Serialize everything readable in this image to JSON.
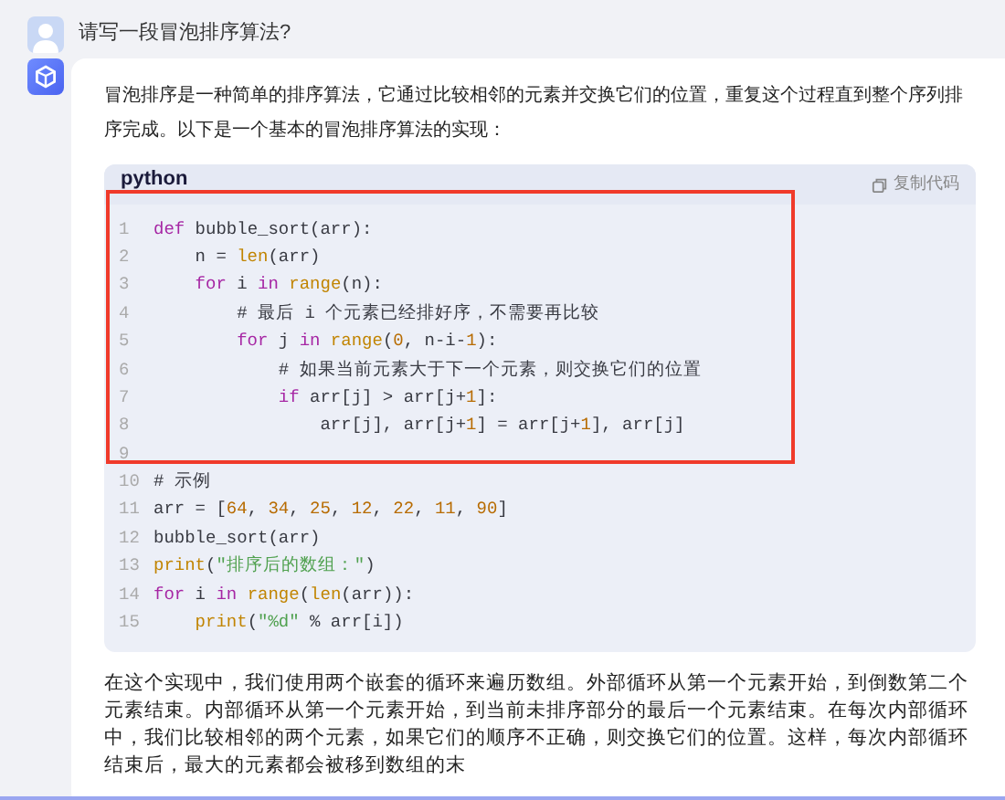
{
  "question": {
    "text": "请写一段冒泡排序算法?"
  },
  "answer": {
    "intro": "冒泡排序是一种简单的排序算法，它通过比较相邻的元素并交换它们的位置，重复这个过程直到整个序列排序完成。以下是一个基本的冒泡排序算法的实现：",
    "code": {
      "language": "python",
      "copy_label": "复制代码",
      "highlight": true,
      "lines": [
        {
          "number": "1",
          "tokens": [
            {
              "kind": "keyword",
              "text": "def"
            },
            {
              "kind": "plain",
              "text": " bubble_sort(arr):"
            }
          ]
        },
        {
          "number": "2",
          "tokens": [
            {
              "kind": "plain",
              "text": "    n = "
            },
            {
              "kind": "builtin",
              "text": "len"
            },
            {
              "kind": "plain",
              "text": "(arr)"
            }
          ]
        },
        {
          "number": "3",
          "tokens": [
            {
              "kind": "keyword",
              "text": "    for"
            },
            {
              "kind": "plain",
              "text": " i "
            },
            {
              "kind": "keyword",
              "text": "in"
            },
            {
              "kind": "builtin",
              "text": " range"
            },
            {
              "kind": "plain",
              "text": "(n):"
            }
          ]
        },
        {
          "number": "4",
          "tokens": [
            {
              "kind": "comment",
              "text": "        # 最后 i 个元素已经排好序，不需要再比较"
            }
          ]
        },
        {
          "number": "5",
          "tokens": [
            {
              "kind": "keyword",
              "text": "        for"
            },
            {
              "kind": "plain",
              "text": " j "
            },
            {
              "kind": "keyword",
              "text": "in"
            },
            {
              "kind": "builtin",
              "text": " range"
            },
            {
              "kind": "plain",
              "text": "("
            },
            {
              "kind": "number",
              "text": "0"
            },
            {
              "kind": "plain",
              "text": ", n-i-"
            },
            {
              "kind": "number",
              "text": "1"
            },
            {
              "kind": "plain",
              "text": "):"
            }
          ]
        },
        {
          "number": "6",
          "tokens": [
            {
              "kind": "comment",
              "text": "            # 如果当前元素大于下一个元素，则交换它们的位置"
            }
          ]
        },
        {
          "number": "7",
          "tokens": [
            {
              "kind": "keyword",
              "text": "            if"
            },
            {
              "kind": "plain",
              "text": " arr[j] > arr[j+"
            },
            {
              "kind": "number",
              "text": "1"
            },
            {
              "kind": "plain",
              "text": "]:"
            }
          ]
        },
        {
          "number": "8",
          "tokens": [
            {
              "kind": "plain",
              "text": "                arr[j], arr[j+"
            },
            {
              "kind": "number",
              "text": "1"
            },
            {
              "kind": "plain",
              "text": "] = arr[j+"
            },
            {
              "kind": "number",
              "text": "1"
            },
            {
              "kind": "plain",
              "text": "], arr[j]"
            }
          ]
        },
        {
          "number": "9"
        },
        {
          "number": "10",
          "tokens": [
            {
              "kind": "comment",
              "text": "# 示例"
            }
          ]
        },
        {
          "number": "11",
          "tokens": [
            {
              "kind": "plain",
              "text": "arr = ["
            },
            {
              "kind": "number",
              "text": "64"
            },
            {
              "kind": "plain",
              "text": ", "
            },
            {
              "kind": "number",
              "text": "34"
            },
            {
              "kind": "plain",
              "text": ", "
            },
            {
              "kind": "number",
              "text": "25"
            },
            {
              "kind": "plain",
              "text": ", "
            },
            {
              "kind": "number",
              "text": "12"
            },
            {
              "kind": "plain",
              "text": ", "
            },
            {
              "kind": "number",
              "text": "22"
            },
            {
              "kind": "plain",
              "text": ", "
            },
            {
              "kind": "number",
              "text": "11"
            },
            {
              "kind": "plain",
              "text": ", "
            },
            {
              "kind": "number",
              "text": "90"
            },
            {
              "kind": "plain",
              "text": "]"
            }
          ]
        },
        {
          "number": "12",
          "tokens": [
            {
              "kind": "plain",
              "text": "bubble_sort(arr)"
            }
          ]
        },
        {
          "number": "13",
          "tokens": [
            {
              "kind": "builtin",
              "text": "print"
            },
            {
              "kind": "plain",
              "text": "("
            },
            {
              "kind": "string",
              "text": "\"排序后的数组：\""
            },
            {
              "kind": "plain",
              "text": ")"
            }
          ]
        },
        {
          "number": "14",
          "tokens": [
            {
              "kind": "keyword",
              "text": "for"
            },
            {
              "kind": "plain",
              "text": " i "
            },
            {
              "kind": "keyword",
              "text": "in"
            },
            {
              "kind": "builtin",
              "text": " range"
            },
            {
              "kind": "plain",
              "text": "("
            },
            {
              "kind": "builtin",
              "text": "len"
            },
            {
              "kind": "plain",
              "text": "(arr)):"
            }
          ]
        },
        {
          "number": "15",
          "tokens": [
            {
              "kind": "builtin",
              "text": "    print"
            },
            {
              "kind": "plain",
              "text": "("
            },
            {
              "kind": "string",
              "text": "\"%d\""
            },
            {
              "kind": "plain",
              "text": " % arr[i])"
            }
          ]
        }
      ]
    },
    "outro": "在这个实现中，我们使用两个嵌套的循环来遍历数组。外部循环从第一个元素开始，到倒数第二个元素结束。内部循环从第一个元素开始，到当前未排序部分的最后一个元素结束。在每次内部循环中，我们比较相邻的两个元素，如果它们的顺序不正确，则交换它们的位置。这样，每次内部循环结束后，最大的元素都会被移到数组的末"
  }
}
